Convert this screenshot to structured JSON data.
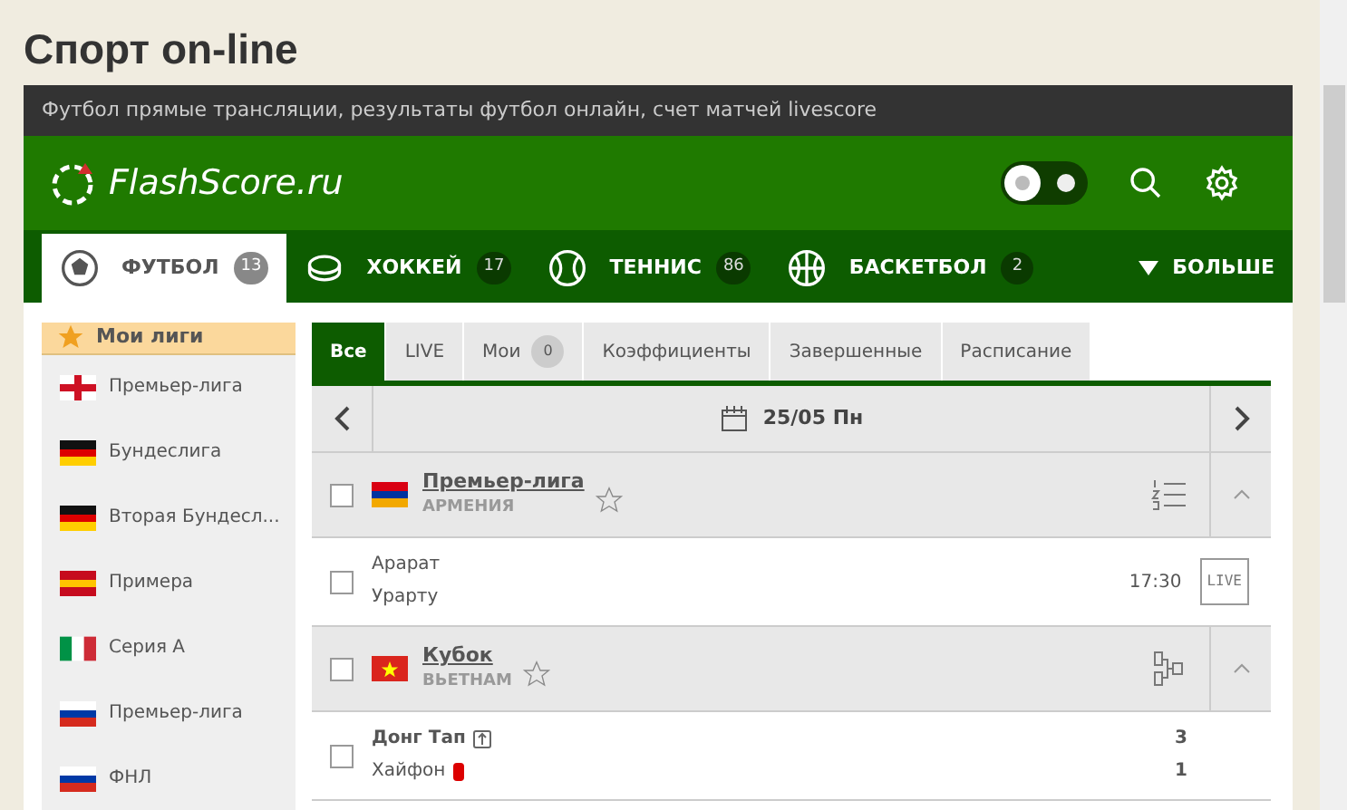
{
  "page_title": "Спорт on-line",
  "banner": "Футбол прямые трансляции, результаты футбол онлайн, счет матчей livescore",
  "logo": "FlashScore.ru",
  "theme_toggle": {
    "dark": false
  },
  "sports": [
    {
      "label": "ФУТБОЛ",
      "count": "13",
      "selected": true
    },
    {
      "label": "ХОККЕЙ",
      "count": "17",
      "selected": false
    },
    {
      "label": "ТЕННИС",
      "count": "86",
      "selected": false
    },
    {
      "label": "БАСКЕТБОЛ",
      "count": "2",
      "selected": false
    }
  ],
  "more": "БОЛЬШЕ",
  "sidebar": {
    "header": "Мои лиги",
    "items": [
      "Премьер-лига",
      "Бундеслига",
      "Вторая Бундесл...",
      "Примера",
      "Серия A",
      "Премьер-лига",
      "ФНЛ"
    ]
  },
  "tabs": [
    {
      "label": "Все",
      "selected": true
    },
    {
      "label": "LIVE",
      "selected": false
    },
    {
      "label": "Мои",
      "count": "0",
      "selected": false
    },
    {
      "label": "Коэффициенты",
      "selected": false
    },
    {
      "label": "Завершенные",
      "selected": false
    },
    {
      "label": "Расписание",
      "selected": false
    }
  ],
  "date": "25/05 Пн",
  "rows": [
    {
      "kind": "league",
      "name": "Премьер-лига",
      "country": "АРМЕНИЯ",
      "checked": false
    },
    {
      "kind": "match",
      "home": "Арарат",
      "away": "Урарту",
      "time": "17:30",
      "badge": "LIVE",
      "checked": false
    },
    {
      "kind": "league",
      "name": "Кубок",
      "country": "ВЬЕТНАМ",
      "checked": false
    },
    {
      "kind": "match",
      "home": "Донг Тап",
      "away": "Хайфон",
      "home_score": "3",
      "away_score": "1",
      "checked": false
    }
  ]
}
